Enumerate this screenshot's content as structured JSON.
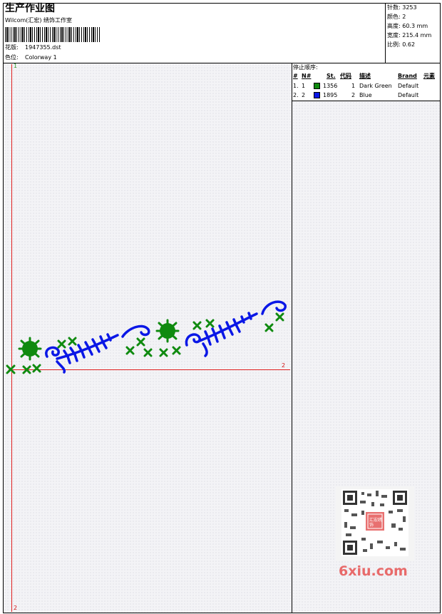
{
  "header": {
    "title": "生产作业图",
    "subtitle": "Wilcom(汇宏) 绣饰工作室",
    "design_label": "花版:",
    "design_value": "1947355.dst",
    "colorway_label": "色位:",
    "colorway_value": "Colorway 1"
  },
  "stats": {
    "stitches": "针数: 3253",
    "colors": "颜色: 2",
    "height": "高度: 60.3 mm",
    "width": "宽度: 215.4 mm",
    "scale": "比例: 0.62"
  },
  "stop_sequence": {
    "title": "停止顺序:",
    "headers": [
      "#",
      "N#",
      "St.",
      "代码",
      "描述",
      "Brand",
      "元素"
    ],
    "rows": [
      {
        "index": "1.",
        "needle": "1",
        "color": "#0f8a0f",
        "stitches": "1356",
        "code": "1",
        "description": "Dark Green",
        "brand": "Default"
      },
      {
        "index": "2.",
        "needle": "2",
        "color": "#0a17e6",
        "stitches": "1895",
        "code": "2",
        "description": "Blue",
        "brand": "Default"
      }
    ]
  },
  "markers": {
    "top_left": "1",
    "right": "2",
    "bottom_left": "2"
  },
  "watermark": {
    "text": "6xiu.com",
    "seal_text": "汇宏绣饰"
  }
}
